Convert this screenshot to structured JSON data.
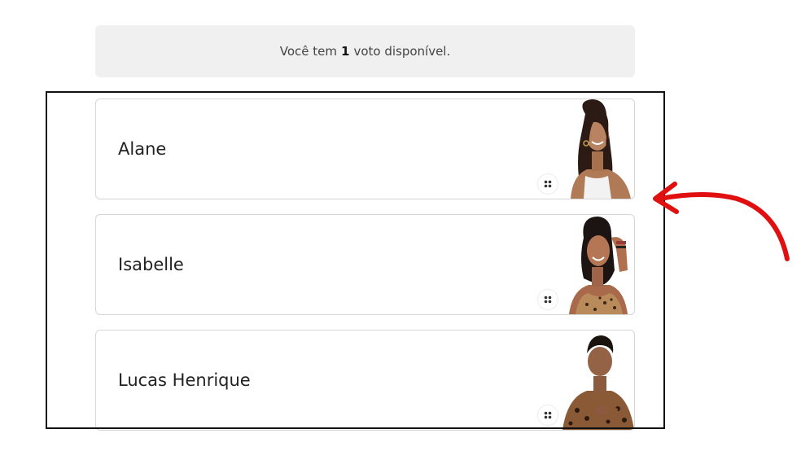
{
  "banner": {
    "prefix": "Você tem",
    "count": "1",
    "suffix": "voto disponível."
  },
  "candidates": [
    {
      "name": "Alane"
    },
    {
      "name": "Isabelle"
    },
    {
      "name": "Lucas Henrique"
    }
  ],
  "icons": {
    "drag_handle": "drag-handle-icon",
    "annotation": "red-curved-arrow"
  },
  "colors": {
    "banner_bg": "#f0f0f0",
    "card_border": "#d6d6d6",
    "arrow": "#e01010",
    "frame": "#111111"
  }
}
